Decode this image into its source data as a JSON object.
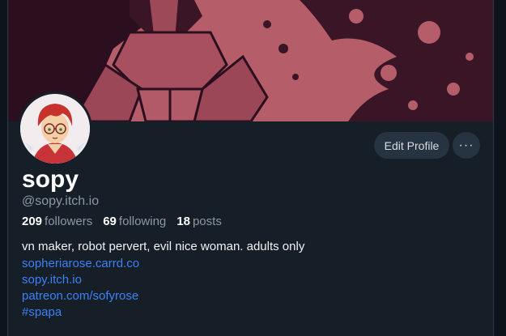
{
  "profile": {
    "display_name": "sopy",
    "handle": "@sopy.itch.io",
    "stats": {
      "followers_count": "209",
      "followers_label": "followers",
      "following_count": "69",
      "following_label": "following",
      "posts_count": "18",
      "posts_label": "posts"
    },
    "bio": "vn maker, robot pervert, evil nice woman. adults only",
    "links": [
      "sopheriarose.carrd.co",
      "sopy.itch.io",
      "patreon.com/sofyrose",
      "#spapa"
    ]
  },
  "actions": {
    "edit_profile_label": "Edit Profile",
    "more_label": "···",
    "more_icon": "more-horizontal-icon"
  },
  "colors": {
    "background": "#161e27",
    "banner_pink": "#b65d6a",
    "banner_dark": "#2b0f1f",
    "link": "#3b82f6",
    "button_bg": "#263340"
  }
}
